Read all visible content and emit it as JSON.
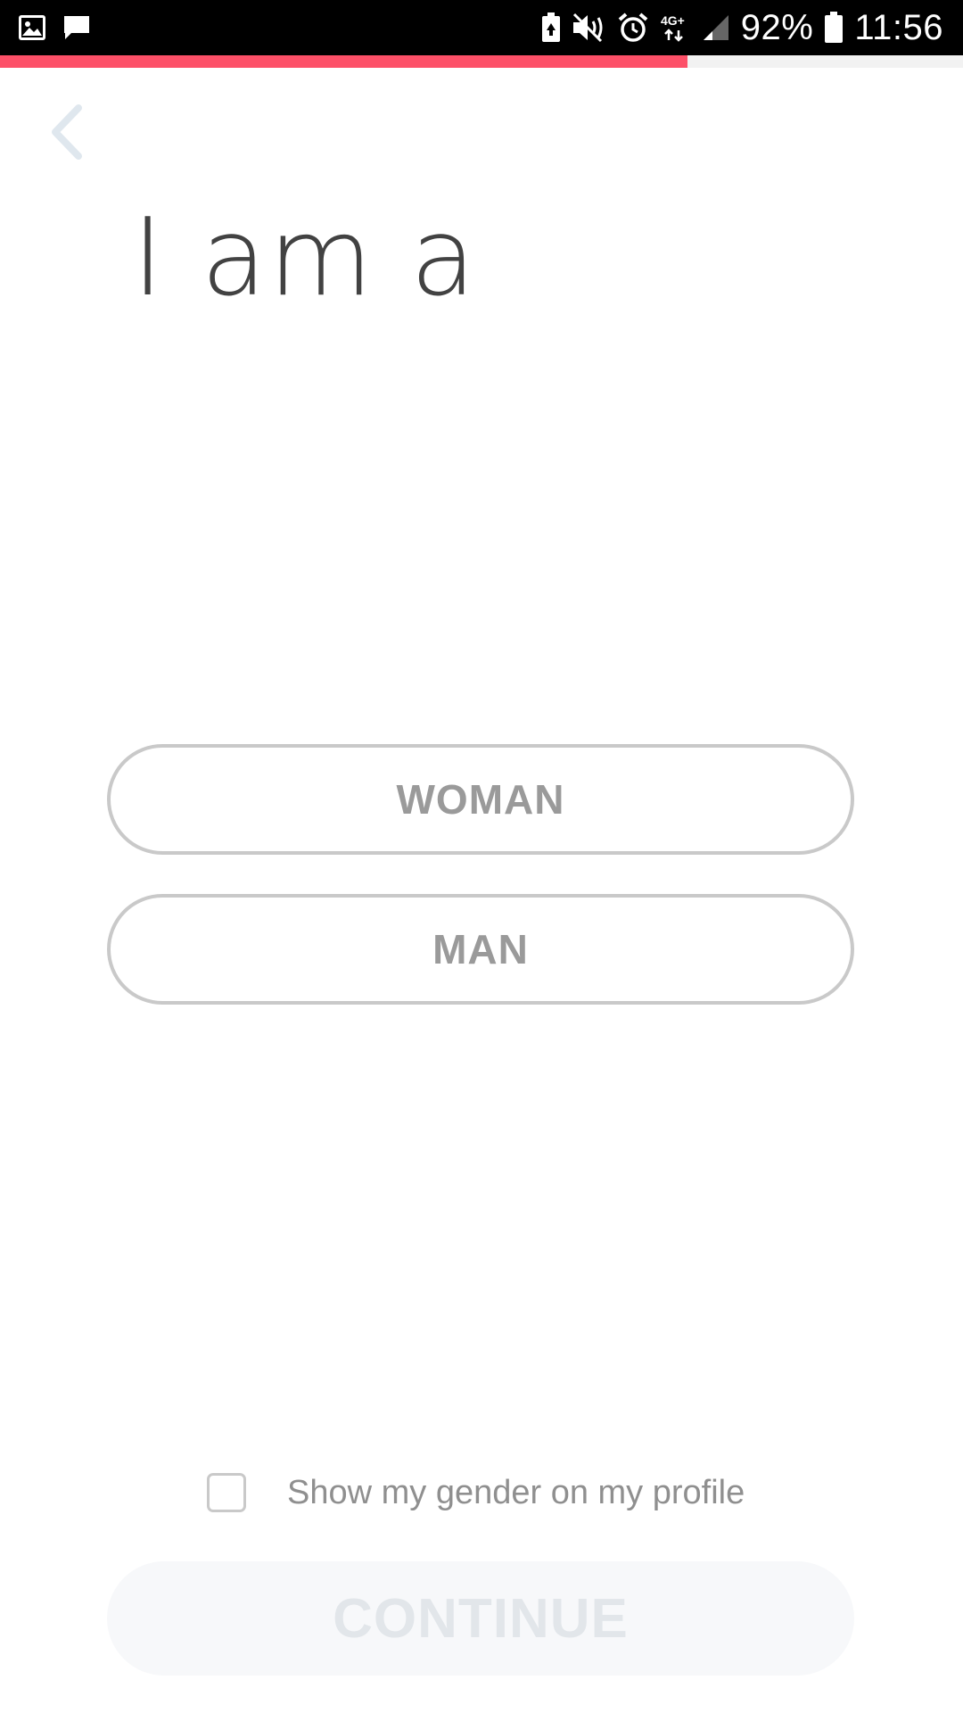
{
  "status_bar": {
    "battery_percent": "92%",
    "time": "11:56",
    "network": "4G+",
    "left_icons": [
      "image-icon",
      "message-icon"
    ],
    "right_icons": [
      "battery-saver-icon",
      "mute-icon",
      "alarm-icon",
      "network-4g-icon",
      "signal-icon",
      "battery-icon"
    ]
  },
  "progress": {
    "fraction": 0.714,
    "color": "#fd5068"
  },
  "header": {
    "back_icon": "chevron-left-icon"
  },
  "title": "I am a",
  "options": [
    {
      "label": "WOMAN"
    },
    {
      "label": "MAN"
    }
  ],
  "show_gender": {
    "label": "Show my gender on my profile",
    "checked": false
  },
  "continue": {
    "label": "CONTINUE",
    "enabled": false
  },
  "colors": {
    "accent": "#fd5068",
    "title_text": "#424242",
    "option_text": "#9a9a9a",
    "option_border": "#c9c9c9",
    "continue_disabled_bg": "#f7f8fa",
    "continue_disabled_text": "#e2e6ea"
  }
}
